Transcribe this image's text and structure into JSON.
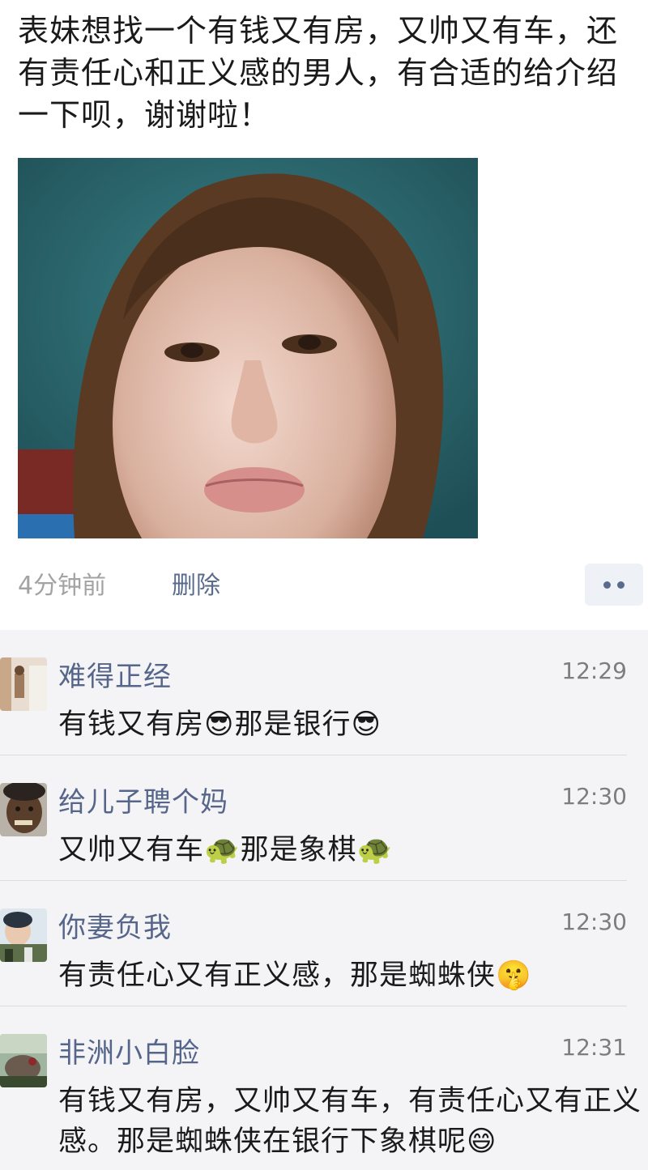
{
  "post": {
    "text": "表妹想找一个有钱又有房，又帅又有车，还有责任心和正义感的男人，有合适的给介绍一下呗，谢谢啦！",
    "time": "4分钟前",
    "delete_label": "删除"
  },
  "comments": [
    {
      "name": "难得正经",
      "time": "12:29",
      "text": "有钱又有房😎那是银行😎"
    },
    {
      "name": "给儿子聘个妈",
      "time": "12:30",
      "text": "又帅又有车🐢那是象棋🐢"
    },
    {
      "name": "你妻负我",
      "time": "12:30",
      "text": "有责任心又有正义感，那是蜘蛛侠🤫"
    },
    {
      "name": "非洲小白脸",
      "time": "12:31",
      "text": "有钱又有房，又帅又有车，有责任心又有正义感。那是蜘蛛侠在银行下象棋呢😄"
    }
  ],
  "icons": {
    "more": "more-dots-icon"
  },
  "colors": {
    "name_link": "#56658a",
    "timestamp": "#a3a3a3",
    "comment_bg": "#f4f4f6"
  }
}
